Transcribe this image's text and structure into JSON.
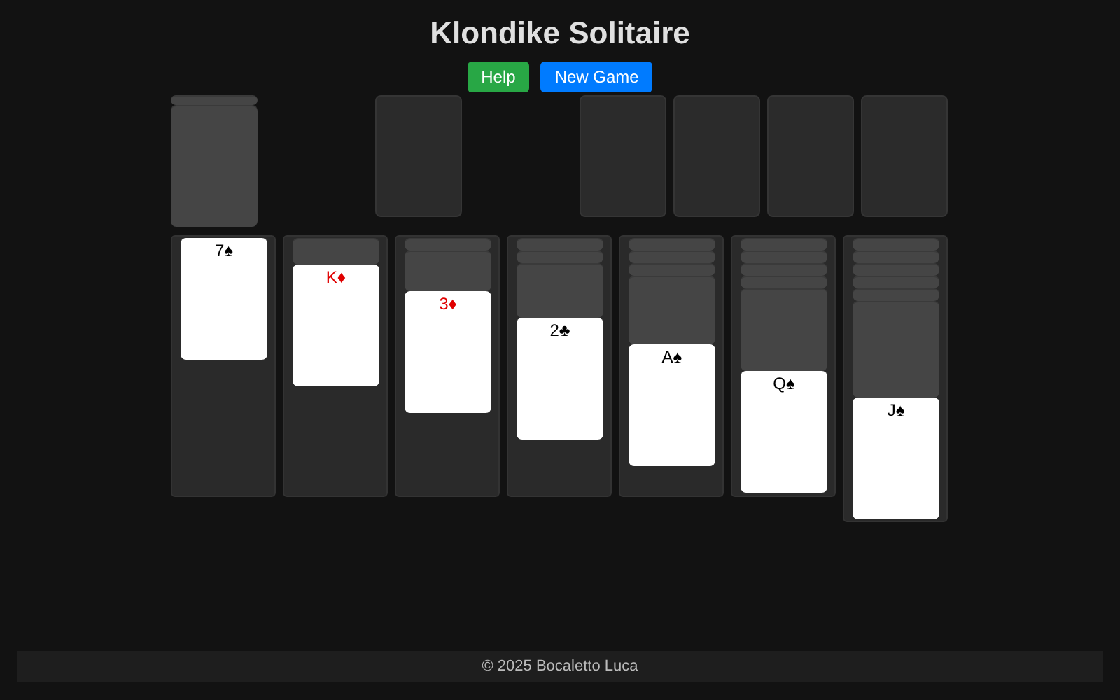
{
  "title": "Klondike Solitaire",
  "buttons": [
    {
      "label": "Help",
      "color": "#28a745"
    },
    {
      "label": "New Game",
      "color": "#007bff"
    }
  ],
  "stock": {
    "cards": [
      {
        "face_up": false
      },
      {
        "face_up": false
      }
    ]
  },
  "tableau": [
    {
      "cards": [
        {
          "face_up": true,
          "label": "7♠",
          "color": "#000000"
        }
      ]
    },
    {
      "cards": [
        {
          "face_up": false
        },
        {
          "face_up": true,
          "label": "K♦",
          "color": "#e00000"
        }
      ]
    },
    {
      "cards": [
        {
          "face_up": false
        },
        {
          "face_up": false
        },
        {
          "face_up": true,
          "label": "3♦",
          "color": "#e00000"
        }
      ]
    },
    {
      "cards": [
        {
          "face_up": false
        },
        {
          "face_up": false
        },
        {
          "face_up": false
        },
        {
          "face_up": true,
          "label": "2♣",
          "color": "#000000"
        }
      ]
    },
    {
      "cards": [
        {
          "face_up": false
        },
        {
          "face_up": false
        },
        {
          "face_up": false
        },
        {
          "face_up": false
        },
        {
          "face_up": true,
          "label": "A♠",
          "color": "#000000"
        }
      ]
    },
    {
      "cards": [
        {
          "face_up": false
        },
        {
          "face_up": false
        },
        {
          "face_up": false
        },
        {
          "face_up": false
        },
        {
          "face_up": false
        },
        {
          "face_up": true,
          "label": "Q♠",
          "color": "#000000"
        }
      ]
    },
    {
      "cards": [
        {
          "face_up": false
        },
        {
          "face_up": false
        },
        {
          "face_up": false
        },
        {
          "face_up": false
        },
        {
          "face_up": false
        },
        {
          "face_up": false
        },
        {
          "face_up": true,
          "label": "J♠",
          "color": "#000000"
        }
      ]
    }
  ],
  "footer": "© 2025 Bocaletto Luca"
}
